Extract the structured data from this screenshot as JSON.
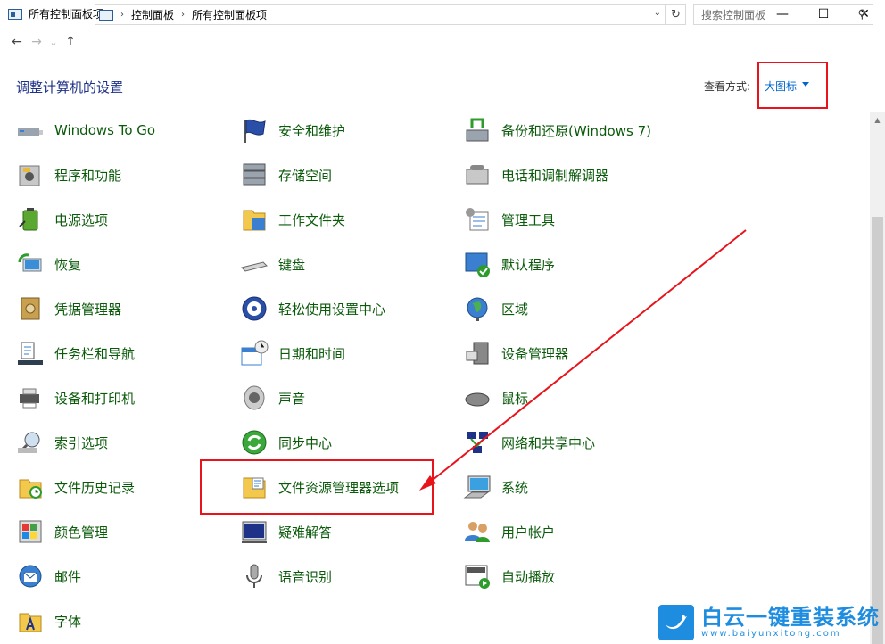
{
  "window": {
    "title": "所有控制面板项",
    "minimize": "—",
    "maximize": "☐",
    "close": "✕"
  },
  "addressbar": {
    "back": "←",
    "forward": "→",
    "recent": "⌄",
    "up": "↑",
    "crumbs": [
      "控制面板",
      "所有控制面板项"
    ],
    "separator": "›",
    "dropdown": "⌄",
    "refresh": "↻",
    "search_placeholder": "搜索控制面板",
    "search_glyph": "⚲"
  },
  "header": {
    "heading": "调整计算机的设置",
    "view_label": "查看方式:",
    "view_value": "大图标"
  },
  "items": {
    "col1": [
      {
        "label": "Windows To Go",
        "icon": "usb-drive-icon"
      },
      {
        "label": "程序和功能",
        "icon": "programs-icon"
      },
      {
        "label": "电源选项",
        "icon": "battery-icon"
      },
      {
        "label": "恢复",
        "icon": "recovery-icon"
      },
      {
        "label": "凭据管理器",
        "icon": "vault-icon"
      },
      {
        "label": "任务栏和导航",
        "icon": "taskbar-icon"
      },
      {
        "label": "设备和打印机",
        "icon": "printer-icon"
      },
      {
        "label": "索引选项",
        "icon": "index-icon"
      },
      {
        "label": "文件历史记录",
        "icon": "file-history-icon"
      },
      {
        "label": "颜色管理",
        "icon": "color-icon"
      },
      {
        "label": "邮件",
        "icon": "mail-icon"
      },
      {
        "label": "字体",
        "icon": "font-icon"
      }
    ],
    "col2": [
      {
        "label": "安全和维护",
        "icon": "flag-icon"
      },
      {
        "label": "存储空间",
        "icon": "storage-icon"
      },
      {
        "label": "工作文件夹",
        "icon": "work-folder-icon"
      },
      {
        "label": "键盘",
        "icon": "keyboard-icon"
      },
      {
        "label": "轻松使用设置中心",
        "icon": "ease-of-access-icon"
      },
      {
        "label": "日期和时间",
        "icon": "calendar-icon"
      },
      {
        "label": "声音",
        "icon": "speaker-icon"
      },
      {
        "label": "同步中心",
        "icon": "sync-icon"
      },
      {
        "label": "文件资源管理器选项",
        "icon": "folder-options-icon"
      },
      {
        "label": "疑难解答",
        "icon": "troubleshoot-icon"
      },
      {
        "label": "语音识别",
        "icon": "microphone-icon"
      }
    ],
    "col3": [
      {
        "label": "备份和还原(Windows 7)",
        "icon": "backup-icon"
      },
      {
        "label": "电话和调制解调器",
        "icon": "phone-icon"
      },
      {
        "label": "管理工具",
        "icon": "admin-tools-icon"
      },
      {
        "label": "默认程序",
        "icon": "default-programs-icon"
      },
      {
        "label": "区域",
        "icon": "globe-icon"
      },
      {
        "label": "设备管理器",
        "icon": "device-manager-icon"
      },
      {
        "label": "鼠标",
        "icon": "mouse-icon"
      },
      {
        "label": "网络和共享中心",
        "icon": "network-icon"
      },
      {
        "label": "系统",
        "icon": "computer-icon"
      },
      {
        "label": "用户帐户",
        "icon": "users-icon"
      },
      {
        "label": "自动播放",
        "icon": "autoplay-icon"
      }
    ]
  },
  "watermark": {
    "main": "白云一键重装系统",
    "sub": "www.baiyunxitong.com"
  },
  "colors": {
    "item_text": "#0a5a0a",
    "heading": "#1e3287",
    "link": "#0066cc",
    "annotation": "#e8141c",
    "watermark": "#1e8de0"
  }
}
